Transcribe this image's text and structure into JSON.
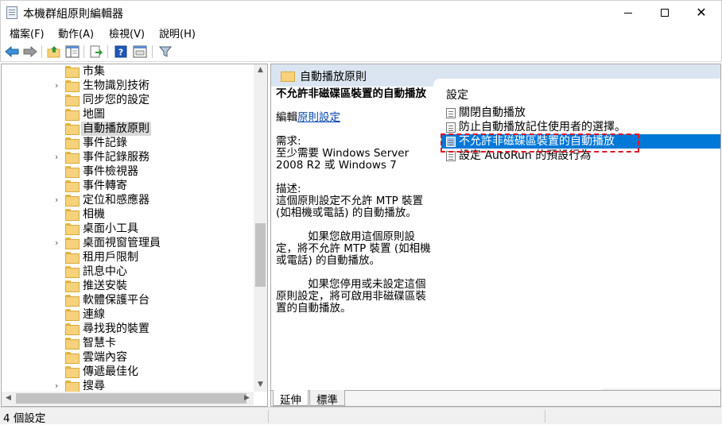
{
  "window": {
    "title": "本機群組原則編輯器"
  },
  "menu": [
    {
      "label": "檔案(F)"
    },
    {
      "label": "動作(A)"
    },
    {
      "label": "檢視(V)"
    },
    {
      "label": "說明(H)"
    }
  ],
  "toolbar": {
    "buttons": [
      "back-arrow",
      "forward-arrow",
      "up-folder",
      "show-hide-tree",
      "export-list",
      "help",
      "properties-view",
      "filter"
    ]
  },
  "tree": {
    "items": [
      {
        "label": "市集",
        "expandable": false
      },
      {
        "label": "生物識別技術",
        "expandable": true
      },
      {
        "label": "同步您的設定",
        "expandable": false
      },
      {
        "label": "地圖",
        "expandable": false
      },
      {
        "label": "自動播放原則",
        "expandable": false,
        "selected": true
      },
      {
        "label": "事件記錄",
        "expandable": false
      },
      {
        "label": "事件記錄服務",
        "expandable": true
      },
      {
        "label": "事件檢視器",
        "expandable": false
      },
      {
        "label": "事件轉寄",
        "expandable": false
      },
      {
        "label": "定位和感應器",
        "expandable": true
      },
      {
        "label": "相機",
        "expandable": false
      },
      {
        "label": "桌面小工具",
        "expandable": false
      },
      {
        "label": "桌面視窗管理員",
        "expandable": true
      },
      {
        "label": "租用戶限制",
        "expandable": false
      },
      {
        "label": "訊息中心",
        "expandable": false
      },
      {
        "label": "推送安裝",
        "expandable": false
      },
      {
        "label": "軟體保護平台",
        "expandable": false
      },
      {
        "label": "連線",
        "expandable": false
      },
      {
        "label": "尋找我的裝置",
        "expandable": false
      },
      {
        "label": "智慧卡",
        "expandable": false
      },
      {
        "label": "雲端內容",
        "expandable": false
      },
      {
        "label": "傳遞最佳化",
        "expandable": false
      },
      {
        "label": "搜尋",
        "expandable": true
      }
    ]
  },
  "details": {
    "header": "自動播放原則",
    "desc_title": "不允許非磁碟區裝置的自動播放",
    "edit_prefix": "編輯",
    "edit_link": "原則設定",
    "req_label": "需求:",
    "req_text": "至少需要 Windows Server 2008 R2 或 Windows 7",
    "desc_label": "描述:",
    "desc_p1": "這個原則設定不允許 MTP 裝置 (如相機或電話) 的自動播放。",
    "desc_p2": "如果您啟用這個原則設定，將不允許 MTP 裝置 (如相機或電話) 的自動播放。",
    "desc_p3": "如果您停用或未設定這個原則設定，將可啟用非磁碟區裝置的自動播放。"
  },
  "settings": {
    "column": "設定",
    "items": [
      {
        "label": "關閉自動播放"
      },
      {
        "label": "防止自動播放記住使用者的選擇。"
      },
      {
        "label": "不允許非磁碟區裝置的自動播放",
        "selected": true
      },
      {
        "label": "設定 AutoRun 的預設行為"
      }
    ]
  },
  "tabs": [
    {
      "label": "延伸",
      "active": true
    },
    {
      "label": "標準",
      "active": false
    }
  ],
  "status": {
    "text": "4 個設定"
  },
  "colors": {
    "selection": "#0078d7",
    "highlight": "#e0132a",
    "header_bg": "#dbe5f1"
  }
}
